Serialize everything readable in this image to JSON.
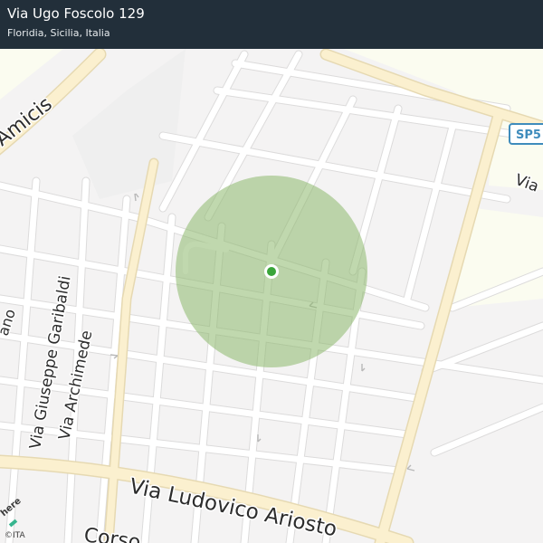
{
  "header": {
    "title": "Via Ugo Foscolo 129",
    "subtitle": "Floridia, Sicilia, Italia",
    "background_color": "#222f3a"
  },
  "map": {
    "streets": {
      "amicis": "Amicis",
      "garibaldi": "Via Giuseppe Garibaldi",
      "archimede": "Via Archimede",
      "ariosto": "Via Ludovico Ariosto",
      "corso": "Corso",
      "ano": "ano",
      "via_partial": "Via"
    },
    "road_shield": "SP5",
    "accuracy_circle_color": "#8db86c",
    "location_marker_color": "#3aa53a",
    "land_color": "#f4f3f3",
    "park_color": "#fbfcf0",
    "major_road_color": "#fbf0cf"
  },
  "attribution": {
    "logo": "here",
    "copyright": "©ITA"
  }
}
